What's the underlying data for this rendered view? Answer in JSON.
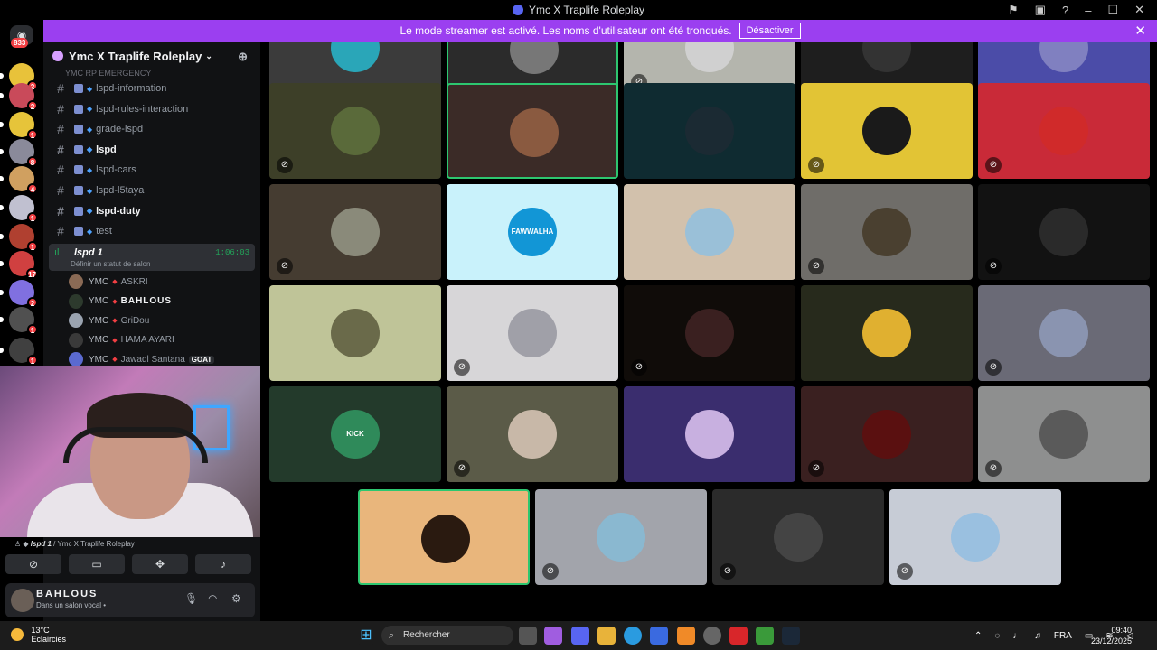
{
  "window": {
    "title": "Ymc X Traplife Roleplay",
    "controls": [
      "flag-icon",
      "monitor-icon",
      "help-icon",
      "minimize-icon",
      "maximize-icon",
      "close-icon"
    ]
  },
  "banner": {
    "text": "Le mode streamer est activé. Les noms d'utilisateur ont été tronqués.",
    "button": "Désactiver"
  },
  "rail": {
    "home_badge": "833",
    "guild_badges": [
      "2",
      "2",
      "1",
      "8",
      "4",
      "1",
      "1",
      "17",
      "2",
      "1",
      "1"
    ]
  },
  "server": {
    "name": "Ymc X Traplife Roleplay",
    "category_cut": "YMC RP EMERGENCY"
  },
  "channels": [
    {
      "name": "lspd-information",
      "bold": false
    },
    {
      "name": "lspd-rules-interaction",
      "bold": false
    },
    {
      "name": "grade-lspd",
      "bold": false
    },
    {
      "name": "lspd",
      "bold": true
    },
    {
      "name": "lspd-cars",
      "bold": false
    },
    {
      "name": "lspd-l5taya",
      "bold": false
    },
    {
      "name": "lspd-duty",
      "bold": true
    },
    {
      "name": "test",
      "bold": false
    }
  ],
  "voice_channel": {
    "name": "lspd 1",
    "timer": "1:06:03",
    "status": "Définir un statut de salon"
  },
  "members": [
    {
      "tag": "YMC",
      "name": "ASKRI",
      "bold": false,
      "color": "#8a6a55"
    },
    {
      "tag": "YMC",
      "name": "BAHLOUS",
      "bold": true,
      "color": "#2d3a2d"
    },
    {
      "tag": "YMC",
      "name": "GriDou",
      "bold": false,
      "color": "#9aa3b0"
    },
    {
      "tag": "YMC",
      "name": "HAMA AYARI",
      "bold": false,
      "color": "#3a3a3a"
    },
    {
      "tag": "YMC",
      "name": "Jawadl Santana",
      "bold": false,
      "color": "#5b6ad0",
      "badge": "GOAT"
    }
  ],
  "voice_connection": {
    "channel": "lspd 1",
    "server": "Ymc X Traplife Roleplay"
  },
  "user": {
    "name": "BAHLOUS",
    "status": "Dans un salon vocal •"
  },
  "tiles": [
    {
      "bg": "#3b3b3b",
      "av": "#2aa6b8",
      "mute": false,
      "speaking": false
    },
    {
      "bg": "#2b2b2b",
      "av": "#777777",
      "mute": false,
      "speaking": true
    },
    {
      "bg": "#b4b5ad",
      "av": "#d0d0d0",
      "mute": true,
      "speaking": false
    },
    {
      "bg": "#1e1e1e",
      "av": "#333333",
      "mute": false,
      "speaking": false
    },
    {
      "bg": "#4b4ca8",
      "av": "#8080c0",
      "mute": false,
      "speaking": false
    },
    {
      "bg": "#3d3f28",
      "av": "#5a6a3a",
      "mute": true,
      "speaking": false
    },
    {
      "bg": "#3b2b27",
      "av": "#8a5a40",
      "mute": false,
      "speaking": true
    },
    {
      "bg": "#0f2b31",
      "av": "#1b2a33",
      "mute": false,
      "speaking": false
    },
    {
      "bg": "#e2c435",
      "av": "#1a1a1a",
      "mute": true,
      "speaking": false
    },
    {
      "bg": "#c92a38",
      "av": "#d02a2a",
      "mute": true,
      "speaking": false
    },
    {
      "bg": "#453c31",
      "av": "#8a8a7a",
      "mute": true,
      "speaking": false
    },
    {
      "bg": "#c9f2fb",
      "av": "#1296d6",
      "mute": false,
      "speaking": false,
      "label": "FAWWALHA"
    },
    {
      "bg": "#d2c1ac",
      "av": "#9ac0d8",
      "mute": false,
      "speaking": false
    },
    {
      "bg": "#6f6d69",
      "av": "#4a4030",
      "mute": true,
      "speaking": false
    },
    {
      "bg": "#121212",
      "av": "#2a2a2a",
      "mute": true,
      "speaking": false
    },
    {
      "bg": "#bfc498",
      "av": "#6a6a4a",
      "mute": false,
      "speaking": false
    },
    {
      "bg": "#d7d6d8",
      "av": "#a0a0a8",
      "mute": true,
      "speaking": false
    },
    {
      "bg": "#100c09",
      "av": "#3a2020",
      "mute": true,
      "speaking": false
    },
    {
      "bg": "#272a1c",
      "av": "#e0b030",
      "mute": false,
      "speaking": false
    },
    {
      "bg": "#6a6a76",
      "av": "#8a94b0",
      "mute": true,
      "speaking": false
    },
    {
      "bg": "#233a2b",
      "av": "#2f8a5a",
      "mute": false,
      "speaking": false,
      "label": "KICK"
    },
    {
      "bg": "#5b5b48",
      "av": "#c8b8a8",
      "mute": true,
      "speaking": false
    },
    {
      "bg": "#3a2d6e",
      "av": "#c8b0e0",
      "mute": false,
      "speaking": false
    },
    {
      "bg": "#3a2020",
      "av": "#5a1010",
      "mute": true,
      "speaking": false
    },
    {
      "bg": "#8e8f8f",
      "av": "#5a5a5a",
      "mute": true,
      "speaking": false
    },
    {
      "bg": "#e9b67c",
      "av": "#2a1a10",
      "mute": false,
      "speaking": true
    },
    {
      "bg": "#a2a4ab",
      "av": "#8ab8d0",
      "mute": true,
      "speaking": false
    },
    {
      "bg": "#2b2b2b",
      "av": "#444444",
      "mute": true,
      "speaking": false
    },
    {
      "bg": "#c7ccd6",
      "av": "#9ac0e0",
      "mute": true,
      "speaking": false
    }
  ],
  "taskbar": {
    "temp": "13°C",
    "weather": "Eclaircies",
    "search": "Rechercher",
    "lang": "FRA",
    "time": "09:40",
    "date": "23/12/2025"
  },
  "colors": {
    "banner": "#9b3ff0",
    "speaking": "#2dc770",
    "badge": "#f23f43"
  }
}
